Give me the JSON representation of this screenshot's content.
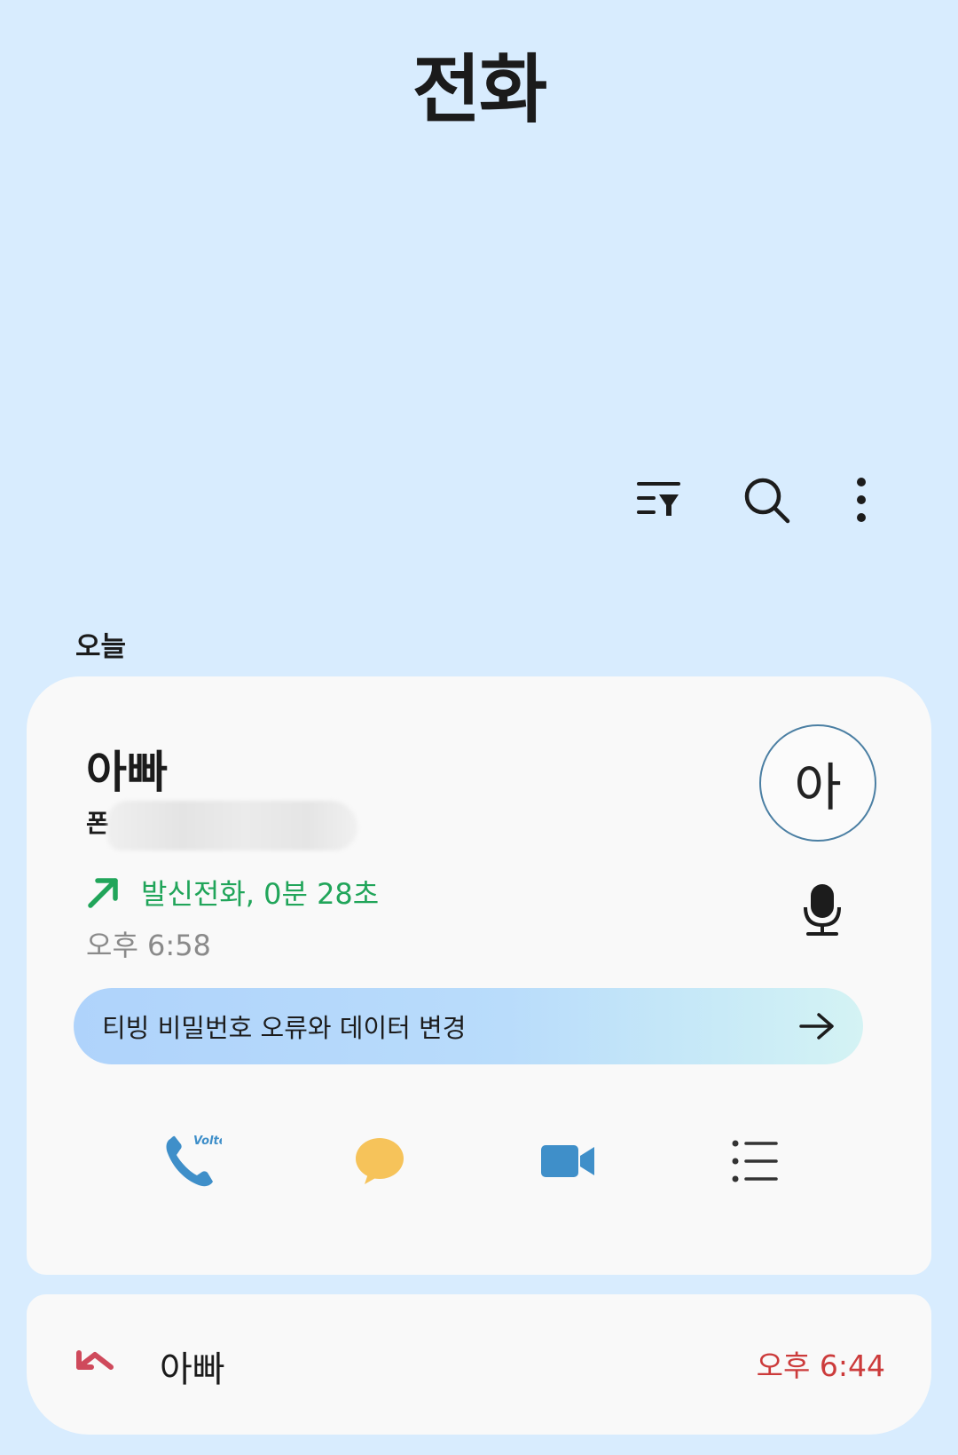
{
  "header": {
    "title": "전화"
  },
  "toolbar": {
    "icons": [
      "filter-icon",
      "search-icon",
      "more-vert-icon"
    ]
  },
  "section": {
    "label": "오늘"
  },
  "expanded_call": {
    "name": "아빠",
    "sub_label": "폰",
    "avatar_initial": "아",
    "call_type_label": "발신전화, 0분 28초",
    "call_type_color": "#21a55a",
    "time": "오후 6:58",
    "promo_text": "티빙 비밀번호 오류와 데이터 변경",
    "actions": [
      "volte-call-icon",
      "message-icon",
      "video-call-icon",
      "details-list-icon"
    ]
  },
  "call_list": [
    {
      "name": "아빠",
      "time": "오후 6:44",
      "type": "missed",
      "time_color": "#cc3b3b"
    }
  ]
}
